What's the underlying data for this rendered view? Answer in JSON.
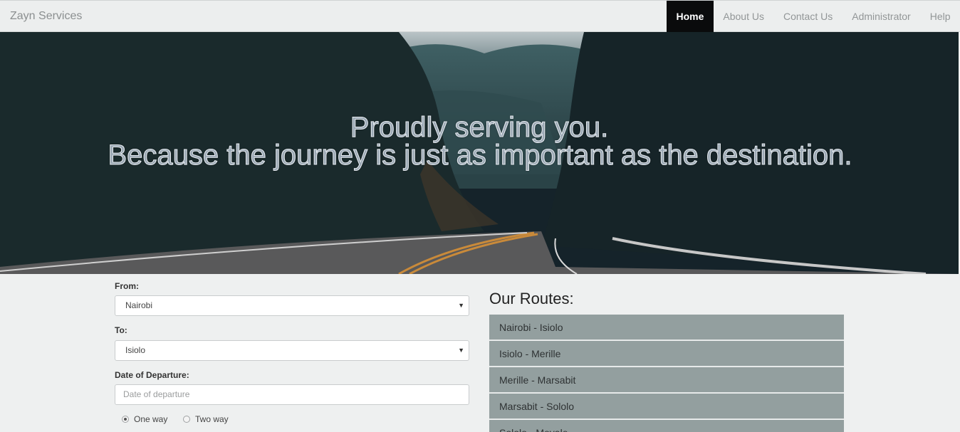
{
  "navbar": {
    "brand": "Zayn Services",
    "items": [
      {
        "label": "Home",
        "active": true
      },
      {
        "label": "About Us",
        "active": false
      },
      {
        "label": "Contact Us",
        "active": false
      },
      {
        "label": "Administrator",
        "active": false
      },
      {
        "label": "Help",
        "active": false
      }
    ]
  },
  "hero": {
    "line1": "Proudly serving you.",
    "line2": "Because the journey is just as important as the destination."
  },
  "form": {
    "from_label": "From:",
    "from_value": "Nairobi",
    "to_label": "To:",
    "to_value": "Isiolo",
    "date_label": "Date of Departure:",
    "date_placeholder": "Date of departure",
    "trip_options": [
      {
        "label": "One way",
        "selected": true
      },
      {
        "label": "Two way",
        "selected": false
      }
    ]
  },
  "routes": {
    "title": "Our Routes:",
    "items": [
      "Nairobi - Isiolo",
      "Isiolo - Merille",
      "Merille - Marsabit",
      "Marsabit - Sololo",
      "Sololo - Moyale"
    ]
  },
  "colors": {
    "nav_active_bg": "#0a0b0c",
    "route_bg": "#939f9f",
    "page_bg": "#eef0f0"
  }
}
